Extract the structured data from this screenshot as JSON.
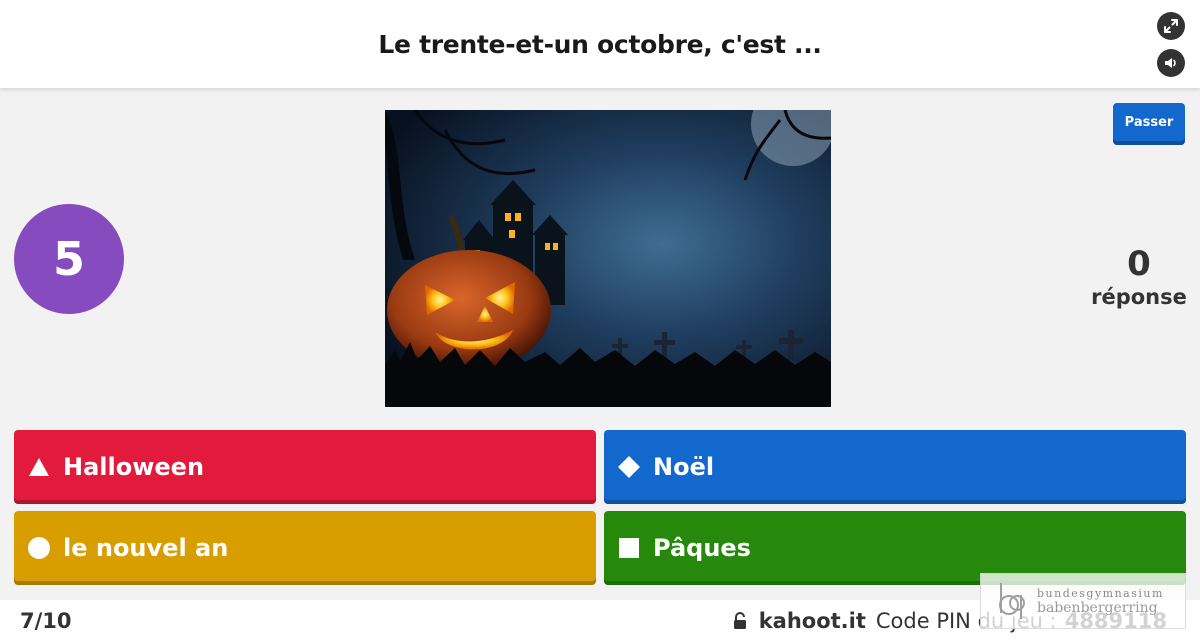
{
  "header": {
    "question": "Le trente-et-un octobre, c'est ..."
  },
  "controls": {
    "fullscreen_icon": "fullscreen-icon",
    "sound_icon": "volume-icon",
    "skip_label": "Passer"
  },
  "timer": {
    "value": "5"
  },
  "answers_count": {
    "value": "0",
    "label": "réponse"
  },
  "answers": [
    {
      "shape": "triangle",
      "label": "Halloween",
      "color": "#e21b3c"
    },
    {
      "shape": "diamond",
      "label": "Noël",
      "color": "#1368ce"
    },
    {
      "shape": "circle",
      "label": "le nouvel an",
      "color": "#d89e00"
    },
    {
      "shape": "square",
      "label": "Pâques",
      "color": "#26890c"
    }
  ],
  "footer": {
    "progress": "7/10",
    "site": "kahoot.it",
    "pin_label": "Code PIN du jeu :",
    "pin_value": "4889118"
  },
  "watermark": {
    "line1": "bundesgymnasium",
    "line2": "babenbergerring"
  },
  "colors": {
    "timer": "#864cbf",
    "skip": "#1368ce"
  }
}
